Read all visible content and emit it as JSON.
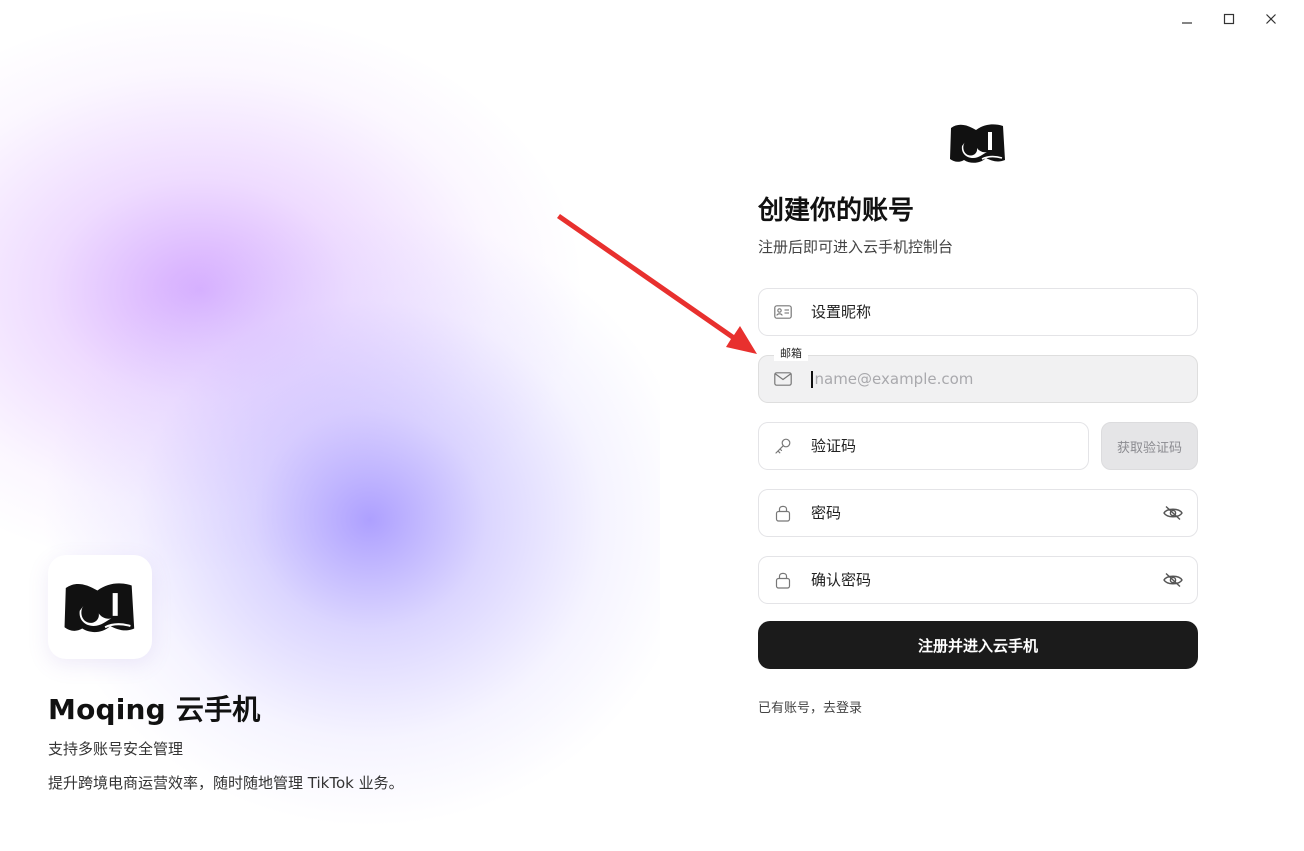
{
  "brand": {
    "title": "Moqing 云手机",
    "subtitle_1": "支持多账号安全管理",
    "subtitle_2": "提升跨境电商运营效率，随时随地管理 TikTok 业务。"
  },
  "form": {
    "title": "创建你的账号",
    "subtitle": "注册后即可进入云手机控制台",
    "nickname_placeholder": "设置昵称",
    "email_label": "邮箱",
    "email_placeholder": "name@example.com",
    "code_placeholder": "验证码",
    "get_code_label": "获取验证码",
    "password_placeholder": "密码",
    "confirm_password_placeholder": "确认密码",
    "submit_label": "注册并进入云手机",
    "login_link": "已有账号，去登录"
  },
  "icons": {
    "nickname": "id-card-icon",
    "email": "mail-icon",
    "code": "key-icon",
    "password": "lock-icon",
    "visibility": "eye-off-icon",
    "window": [
      "minimize-icon",
      "maximize-icon",
      "close-icon"
    ]
  },
  "colors": {
    "primary_button": "#1b1b1b",
    "focused_field_bg": "#f1f1f2",
    "disabled_button_bg": "#e5e5e7",
    "annotation_arrow": "#e8302e"
  }
}
